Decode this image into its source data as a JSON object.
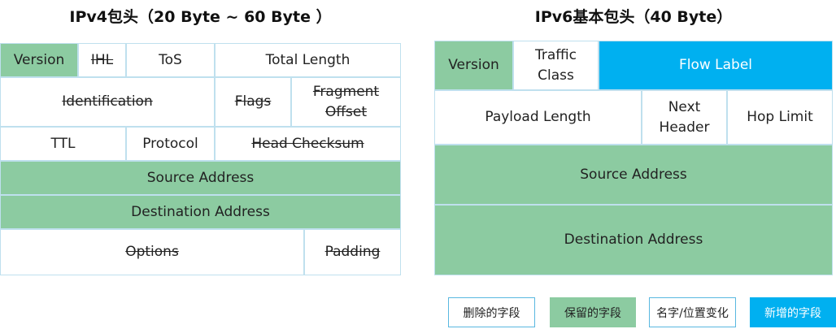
{
  "colors": {
    "removed": "#ffffff",
    "kept": "#8ccba1",
    "renamed": "#ffffff",
    "added": "#00b0f0",
    "border": "#bfe0ee"
  },
  "ipv4": {
    "title": "IPv4包头（20 Byte ~ 60 Byte ）",
    "fields": {
      "version": "Version",
      "ihl": "IHL",
      "tos": "ToS",
      "total_length": "Total Length",
      "identification": "Identification",
      "flags": "Flags",
      "fragment_offset": "Fragment Offset",
      "ttl": "TTL",
      "protocol": "Protocol",
      "head_checksum": "Head Checksum",
      "source_address": "Source Address",
      "destination_address": "Destination Address",
      "options": "Options",
      "padding": "Padding"
    }
  },
  "ipv6": {
    "title": "IPv6基本包头（40 Byte）",
    "fields": {
      "version": "Version",
      "traffic_class": "Traffic Class",
      "flow_label": "Flow Label",
      "payload_length": "Payload Length",
      "next_header": "Next Header",
      "hop_limit": "Hop Limit",
      "source_address": "Source Address",
      "destination_address": "Destination Address"
    }
  },
  "legend": {
    "removed": "删除的字段",
    "kept": "保留的字段",
    "renamed": "名字/位置变化",
    "added": "新增的字段"
  }
}
